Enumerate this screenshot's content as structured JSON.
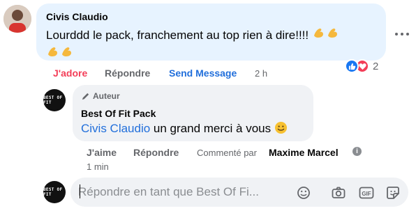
{
  "comment": {
    "author": "Civis Claudio",
    "text": "Lourddd le pack, franchement au top rien à dire!!!!",
    "emojis": [
      "flexed-biceps",
      "flexed-biceps",
      "flexed-biceps",
      "flexed-biceps"
    ],
    "actions": {
      "love_label": "J'adore",
      "reply_label": "Répondre",
      "send_message_label": "Send Message",
      "time": "2 h"
    },
    "reactions": {
      "types": [
        "like",
        "love"
      ],
      "count": "2"
    }
  },
  "reply": {
    "badge": "Auteur",
    "author": "Best Of Fit Pack",
    "logo_text": "BEST OF FIT",
    "mention": "Civis Claudio",
    "text": " un grand merci à vous",
    "emoji": "smiling-face",
    "actions": {
      "like_label": "J'aime",
      "reply_label": "Répondre",
      "commented_by_prefix": "Commenté par",
      "commented_by_name": "Maxime Marcel",
      "time": "1 min"
    }
  },
  "composer": {
    "placeholder": "Répondre en tant que Best Of Fi...",
    "icons": [
      "emoji-icon",
      "camera-icon",
      "gif-icon",
      "sticker-icon"
    ]
  },
  "colors": {
    "love": "#f33e58",
    "link": "#216fdb",
    "muted": "#65676b",
    "bubble_highlight": "#e7f3ff",
    "bubble": "#f0f2f5"
  }
}
